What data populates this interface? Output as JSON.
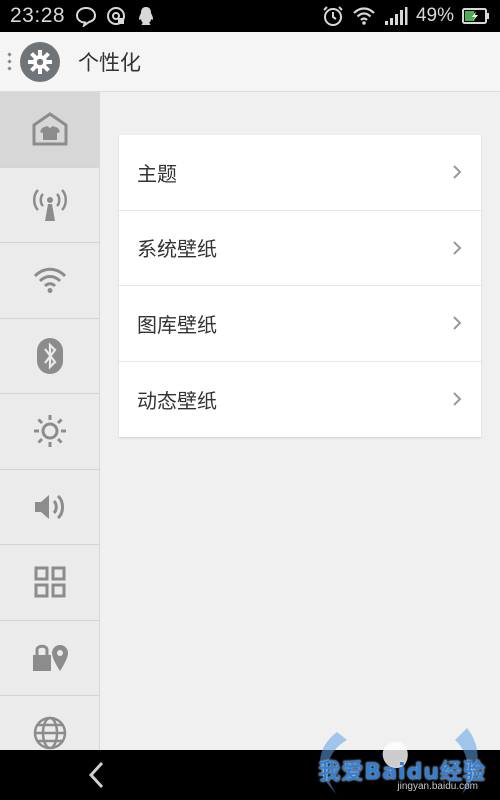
{
  "status_bar": {
    "time": "23:28",
    "battery_percent_text": "49%",
    "battery_level": 0.49,
    "left_icons": [
      "message-icon",
      "mail-icon",
      "qq-icon"
    ],
    "right_icons": [
      "alarm-icon",
      "wifi-icon",
      "signal-icon",
      "battery-icon"
    ]
  },
  "header": {
    "title": "个性化",
    "icon": "gear-icon"
  },
  "sidebar": {
    "items": [
      {
        "icon": "personalization-icon",
        "active": true
      },
      {
        "icon": "tower-icon",
        "active": false
      },
      {
        "icon": "wifi-icon",
        "active": false
      },
      {
        "icon": "bluetooth-icon",
        "active": false
      },
      {
        "icon": "brightness-icon",
        "active": false
      },
      {
        "icon": "volume-icon",
        "active": false
      },
      {
        "icon": "apps-grid-icon",
        "active": false
      },
      {
        "icon": "lock-location-icon",
        "active": false
      },
      {
        "icon": "globe-icon",
        "active": false
      }
    ]
  },
  "main": {
    "items": [
      {
        "label": "主题"
      },
      {
        "label": "系统壁纸"
      },
      {
        "label": "图库壁纸"
      },
      {
        "label": "动态壁纸"
      }
    ]
  },
  "watermark": {
    "text": "我爱Baidu经验",
    "url": "jingyan.baidu.com"
  },
  "colors": {
    "header_bg": "#f5f5f5",
    "sidebar_bg": "#ebebeb",
    "sidebar_active": "#d7d7d7",
    "main_bg": "#f0f0f0",
    "icon_gray": "#8c8c8c",
    "watermark_blue": "#2f7fd8"
  }
}
